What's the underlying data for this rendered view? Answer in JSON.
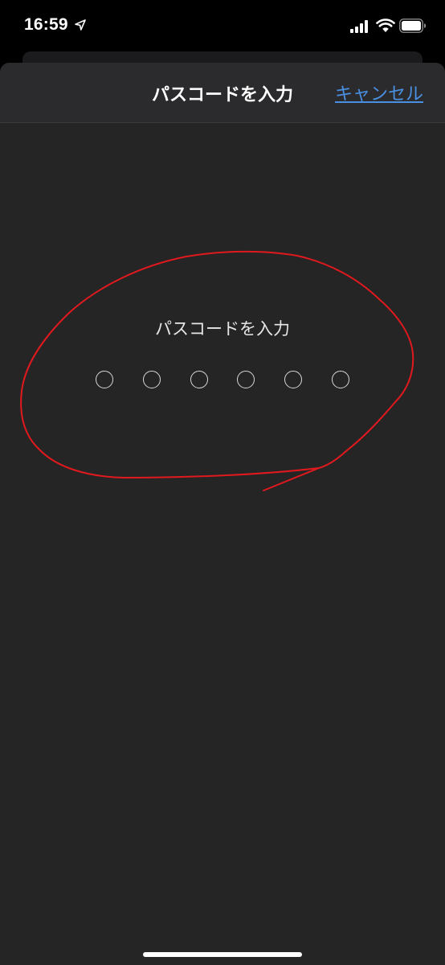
{
  "status_bar": {
    "time": "16:59",
    "icons": [
      "location-arrow-icon",
      "cellular-signal-icon",
      "wifi-icon",
      "battery-icon"
    ]
  },
  "nav": {
    "title": "パスコードを入力",
    "cancel_label": "キャンセル"
  },
  "passcode": {
    "prompt": "パスコードを入力",
    "digit_count": 6,
    "entered": 0
  },
  "colors": {
    "background": "#000000",
    "sheet": "#252525",
    "nav_bar": "#2b2b2d",
    "accent": "#4a90e2",
    "annotation": "#e0191e"
  }
}
